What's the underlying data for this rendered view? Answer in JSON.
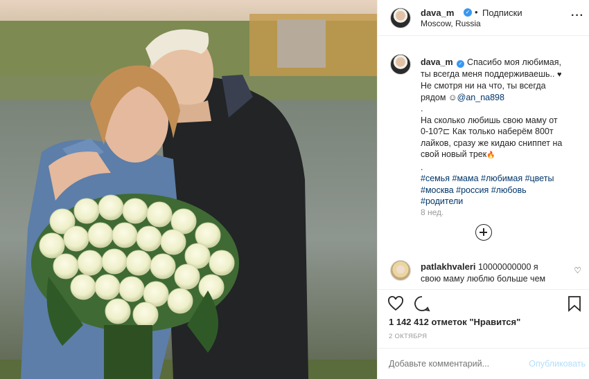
{
  "post": {
    "username": "dava_m",
    "verified_icon": "verified-badge-icon",
    "separator": "•",
    "follow_label": "Подписки",
    "location": "Moscow, Russia",
    "more_icon": "more-options-icon"
  },
  "caption": {
    "username": "dava_m",
    "lines": [
      "Спасибо моя любимая,",
      "ты всегда меня поддерживаешь..",
      "Не смотря ни на что, ты всегда",
      "рядом ☺",
      ".",
      "На сколько любишь свою маму от",
      "0-10?⊏ Как только наберём 800т",
      "лайков, сразу же кидаю сниппет на",
      "свой новый трек",
      "."
    ],
    "heart": "♥",
    "mention": "@an_na898",
    "fire": "🔥",
    "hashtags": [
      "#семья #мама #любимая #цветы",
      "#москва #россия #любовь",
      "#родители"
    ],
    "time_ago": "8 нед.",
    "load_more_icon": "plus-circle-icon"
  },
  "comment": {
    "username": "patlakhvaleri",
    "text_line1": "10000000000 я",
    "text_line2": "свою маму люблю больше чем",
    "heart_icon": "♡"
  },
  "stats": {
    "likes": "1 142 412 отметок \"Нравится\"",
    "date": "2 ОКТЯБРЯ"
  },
  "add_comment": {
    "placeholder": "Добавьте комментарий...",
    "publish_label": "Опубликовать"
  },
  "colors": {
    "accent": "#3897f0",
    "link": "#003569",
    "muted": "#999999",
    "publish_disabled": "#b2dffc"
  }
}
